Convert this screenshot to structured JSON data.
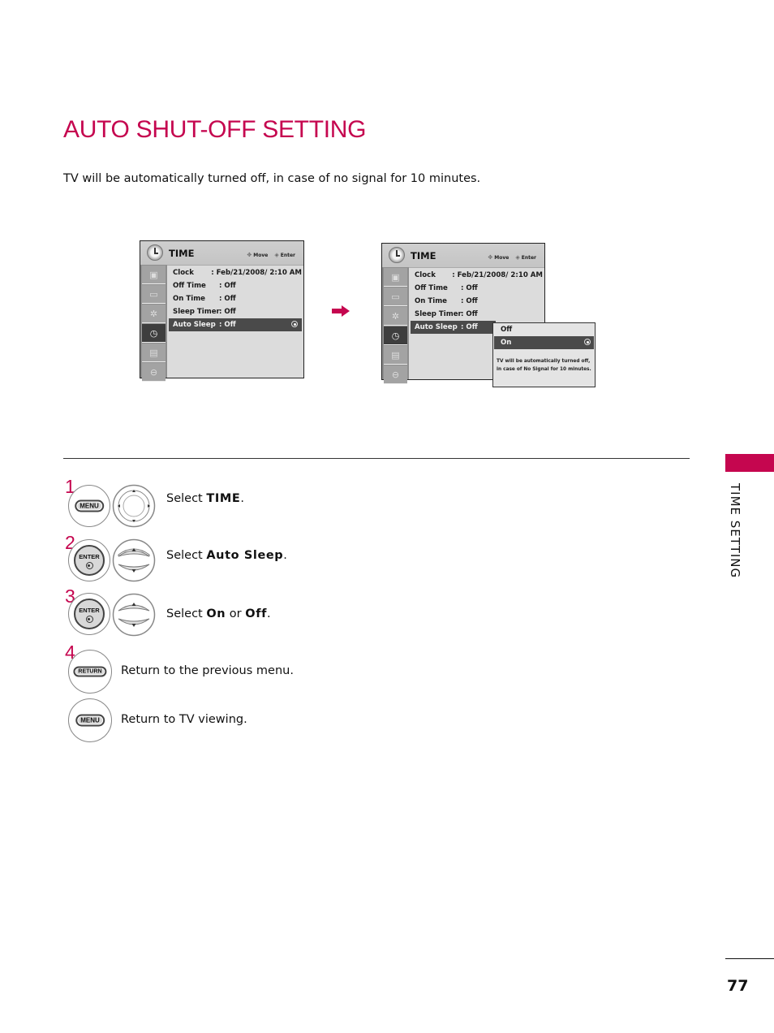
{
  "page": {
    "title": "AUTO SHUT-OFF SETTING",
    "subtitle": "TV will be automatically turned off, in case of no signal for 10 minutes.",
    "section_label": "TIME SETTING",
    "page_number": "77",
    "accent_color": "#c5064f"
  },
  "menu_left": {
    "title": "TIME",
    "hints": {
      "move": "Move",
      "enter": "Enter"
    },
    "side_icons": [
      "picture-icon",
      "audio-icon",
      "setup-icon",
      "time-icon",
      "option-icon",
      "lock-icon"
    ],
    "active_side_index": 3,
    "rows": [
      {
        "label": "Clock",
        "value": ": Feb/21/2008/  2:10 AM"
      },
      {
        "label": "Off Time",
        "value": ": Off"
      },
      {
        "label": "On Time",
        "value": ": Off"
      },
      {
        "label": "Sleep Timer",
        "value": ": Off"
      },
      {
        "label": "Auto Sleep",
        "value": ": Off"
      }
    ],
    "selected_row": 4
  },
  "menu_right": {
    "title": "TIME",
    "hints": {
      "move": "Move",
      "enter": "Enter"
    },
    "rows": [
      {
        "label": "Clock",
        "value": ": Feb/21/2008/  2:10 AM"
      },
      {
        "label": "Off Time",
        "value": ": Off"
      },
      {
        "label": "On Time",
        "value": ": Off"
      },
      {
        "label": "Sleep Timer",
        "value": ": Off"
      },
      {
        "label": "Auto Sleep",
        "value": ": Off"
      }
    ],
    "selected_row": 4,
    "popup": {
      "options": [
        "Off",
        "On"
      ],
      "selected_option": 1,
      "description_line1": "TV will be automatically turned off,",
      "description_line2": "in case of No Signal for 10 minutes."
    }
  },
  "steps": [
    {
      "number": "1",
      "button": "MENU",
      "prefix": "Select ",
      "bold": "TIME",
      "suffix": "."
    },
    {
      "number": "2",
      "button": "ENTER",
      "prefix": "Select ",
      "bold": "Auto Sleep",
      "suffix": "."
    },
    {
      "number": "3",
      "button": "ENTER",
      "prefix": "Select ",
      "bold": "On",
      "middle": " or ",
      "bold2": "Off",
      "suffix": "."
    },
    {
      "number": "4",
      "button": "RETURN",
      "text": "Return to the previous menu."
    },
    {
      "button": "MENU",
      "text": "Return to TV viewing."
    }
  ]
}
